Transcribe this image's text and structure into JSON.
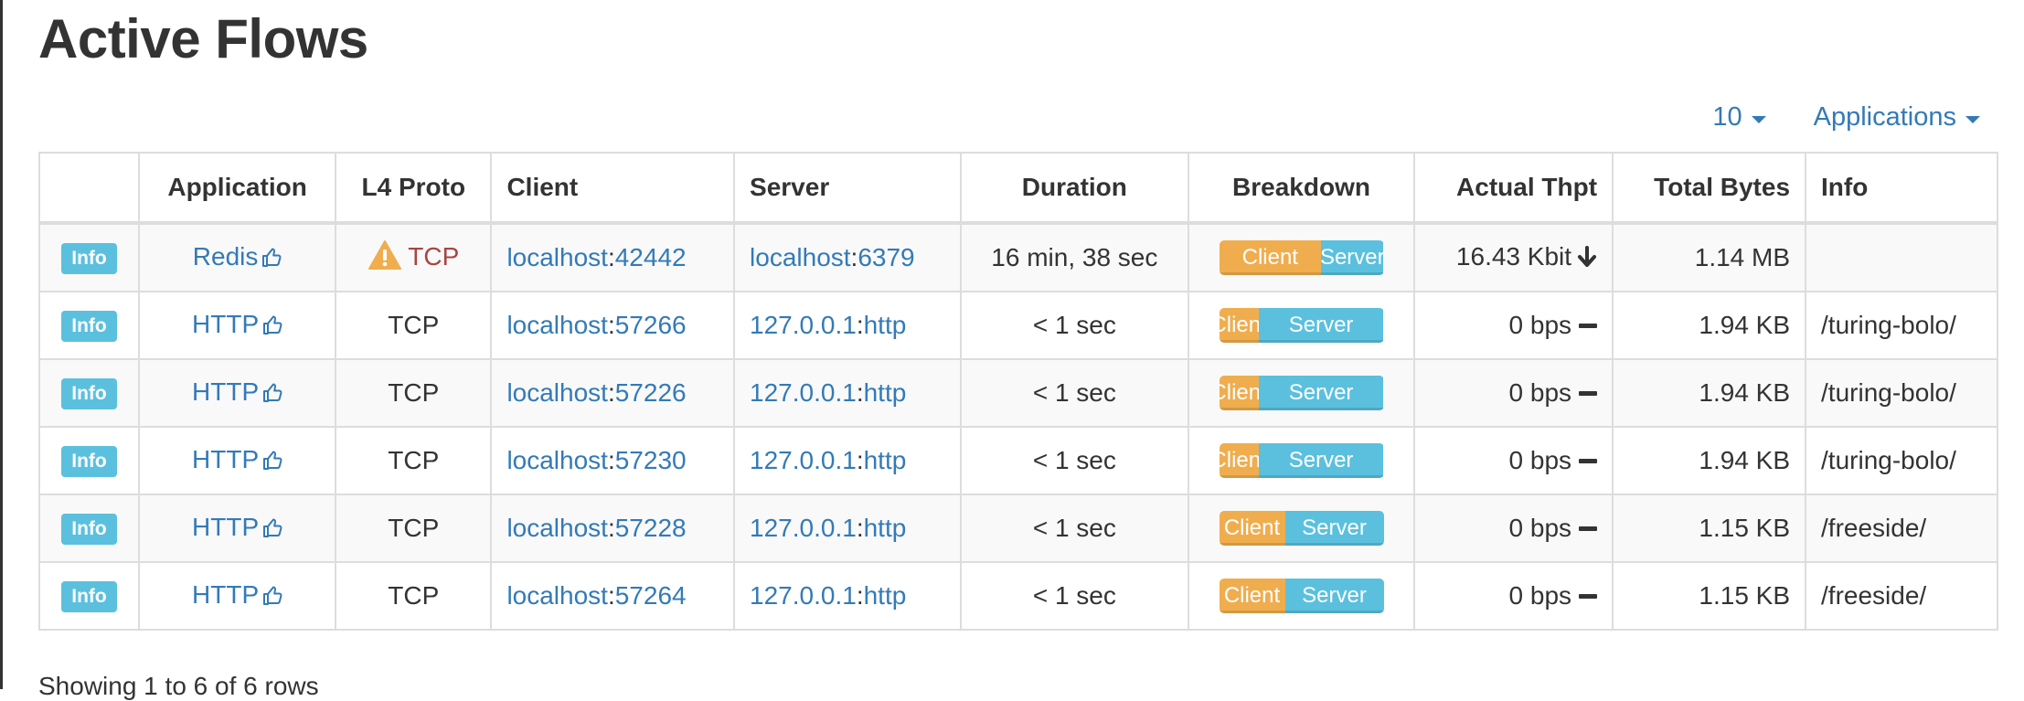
{
  "page": {
    "title": "Active Flows"
  },
  "toolbar": {
    "page_size": "10",
    "filter_label": "Applications"
  },
  "table": {
    "headers": [
      "",
      "Application",
      "L4 Proto",
      "Client",
      "Server",
      "Duration",
      "Breakdown",
      "Actual Thpt",
      "Total Bytes",
      "Info"
    ],
    "rows": [
      {
        "info_btn": "Info",
        "application": "Redis",
        "proto": "TCP",
        "proto_warning": true,
        "client_host": "localhost",
        "client_port": "42442",
        "server_host": "localhost",
        "server_port": "6379",
        "duration": "16 min, 38 sec",
        "client_label": "Client",
        "server_label": "Server",
        "client_pct": 62,
        "thpt": "16.43 Kbit",
        "trend": "down",
        "bytes": "1.14 MB",
        "info": ""
      },
      {
        "info_btn": "Info",
        "application": "HTTP",
        "proto": "TCP",
        "proto_warning": false,
        "client_host": "localhost",
        "client_port": "57266",
        "server_host": "127.0.0.1",
        "server_port": "http",
        "duration": "< 1 sec",
        "client_label": "Client",
        "server_label": "Server",
        "client_pct": 24,
        "thpt": "0 bps",
        "trend": "flat",
        "bytes": "1.94 KB",
        "info": "/turing-bolo/"
      },
      {
        "info_btn": "Info",
        "application": "HTTP",
        "proto": "TCP",
        "proto_warning": false,
        "client_host": "localhost",
        "client_port": "57226",
        "server_host": "127.0.0.1",
        "server_port": "http",
        "duration": "< 1 sec",
        "client_label": "Client",
        "server_label": "Server",
        "client_pct": 24,
        "thpt": "0 bps",
        "trend": "flat",
        "bytes": "1.94 KB",
        "info": "/turing-bolo/"
      },
      {
        "info_btn": "Info",
        "application": "HTTP",
        "proto": "TCP",
        "proto_warning": false,
        "client_host": "localhost",
        "client_port": "57230",
        "server_host": "127.0.0.1",
        "server_port": "http",
        "duration": "< 1 sec",
        "client_label": "Client",
        "server_label": "Server",
        "client_pct": 24,
        "thpt": "0 bps",
        "trend": "flat",
        "bytes": "1.94 KB",
        "info": "/turing-bolo/"
      },
      {
        "info_btn": "Info",
        "application": "HTTP",
        "proto": "TCP",
        "proto_warning": false,
        "client_host": "localhost",
        "client_port": "57228",
        "server_host": "127.0.0.1",
        "server_port": "http",
        "duration": "< 1 sec",
        "client_label": "Client",
        "server_label": "Server",
        "client_pct": 40,
        "thpt": "0 bps",
        "trend": "flat",
        "bytes": "1.15 KB",
        "info": "/freeside/"
      },
      {
        "info_btn": "Info",
        "application": "HTTP",
        "proto": "TCP",
        "proto_warning": false,
        "client_host": "localhost",
        "client_port": "57264",
        "server_host": "127.0.0.1",
        "server_port": "http",
        "duration": "< 1 sec",
        "client_label": "Client",
        "server_label": "Server",
        "client_pct": 40,
        "thpt": "0 bps",
        "trend": "flat",
        "bytes": "1.15 KB",
        "info": "/freeside/"
      }
    ]
  },
  "footer": {
    "text": "Showing 1 to 6 of 6 rows"
  },
  "colors": {
    "link": "#337ab7",
    "info": "#5bc0de",
    "client": "#f0ad4e",
    "warning": "#f0ad4e",
    "danger": "#a94442"
  },
  "icons": {
    "application": "thumbs-up-icon",
    "proto_warning": "warning-triangle-icon",
    "trend_down": "arrow-down-icon",
    "trend_flat": "minus-icon"
  }
}
